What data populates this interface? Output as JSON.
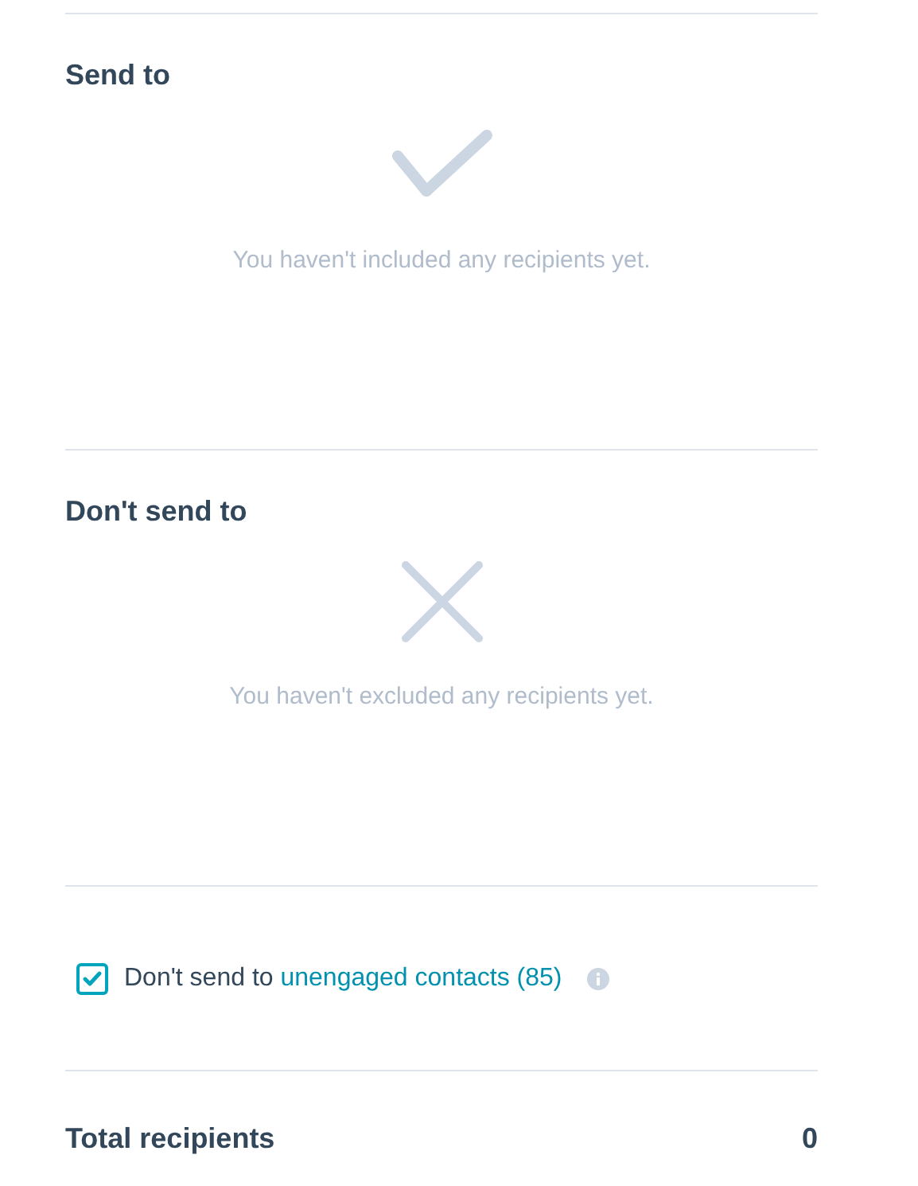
{
  "sections": [
    {
      "kind": "include",
      "title": "Send to",
      "empty_message": "You haven't included any recipients yet."
    },
    {
      "kind": "exclude",
      "title": "Don't send to",
      "empty_message": "You haven't excluded any recipients yet."
    }
  ],
  "unengaged": {
    "checked": true,
    "label": "Don't send to",
    "link": "unengaged contacts (85)"
  },
  "total": {
    "label": "Total recipients",
    "value": "0"
  }
}
